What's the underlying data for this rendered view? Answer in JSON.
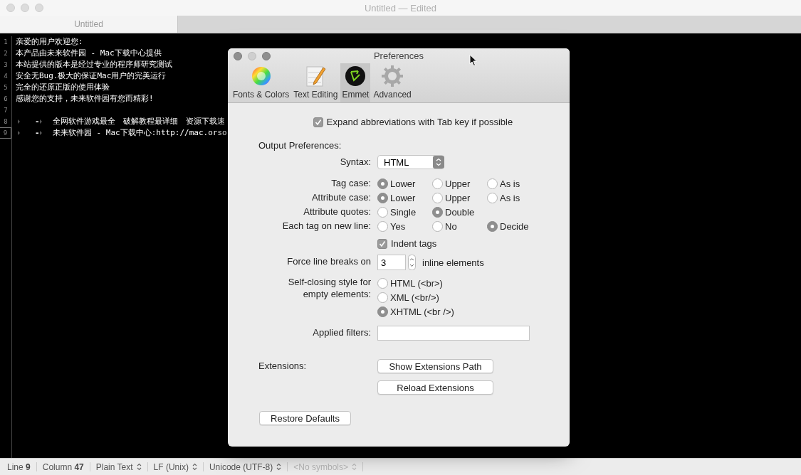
{
  "window": {
    "title": "Untitled — Edited"
  },
  "tabs": [
    {
      "label": "Untitled",
      "selected": true
    }
  ],
  "editor": {
    "lines": [
      {
        "number": "1",
        "kind": "plain",
        "text": "亲爱的用户欢迎您:",
        "current": false
      },
      {
        "number": "2",
        "kind": "plain",
        "text": "本产品由未来软件园 - Mac下载中心提供",
        "current": false
      },
      {
        "number": "3",
        "kind": "plain",
        "text": "本站提供的版本是经过专业的程序师研究测试",
        "current": false
      },
      {
        "number": "4",
        "kind": "plain",
        "text": "安全无Bug.极大的保证Mac用户的完美运行",
        "current": false
      },
      {
        "number": "5",
        "kind": "plain",
        "text": "完全的还原正版的使用体验",
        "current": false
      },
      {
        "number": "6",
        "kind": "plain",
        "text": "感谢您的支持，未来软件园有您而精彩!",
        "current": false
      },
      {
        "number": "7",
        "kind": "blank",
        "current": false
      },
      {
        "number": "8",
        "kind": "bullet",
        "bullet": "-",
        "text": "全网软件游戏最全　破解教程最详细　资源下载速",
        "current": false
      },
      {
        "number": "9",
        "kind": "bullet",
        "bullet": "-",
        "text": "未来软件园 - Mac下载中心:http://mac.orso",
        "current": true
      }
    ]
  },
  "status_bar": {
    "items": [
      {
        "kind": "count",
        "label": "Line",
        "value": "9"
      },
      {
        "kind": "count",
        "label": "Column",
        "value": "47"
      },
      {
        "kind": "popup",
        "label": "Plain Text",
        "disabled": false
      },
      {
        "kind": "popup",
        "label": "LF (Unix)",
        "disabled": false
      },
      {
        "kind": "popup",
        "label": "Unicode (UTF-8)",
        "disabled": false
      },
      {
        "kind": "popup",
        "label": "<No symbols>",
        "disabled": true
      }
    ]
  },
  "preferences": {
    "title": "Preferences",
    "tabs": [
      {
        "kind": "fonts",
        "label": "Fonts & Colors",
        "selected": false
      },
      {
        "kind": "editing",
        "label": "Text Editing",
        "selected": false
      },
      {
        "kind": "emmet",
        "label": "Emmet",
        "selected": true
      },
      {
        "kind": "advanced",
        "label": "Advanced",
        "selected": false
      }
    ],
    "expand_abbreviations": {
      "label": "Expand abbreviations with Tab key if possible",
      "checked": true
    },
    "output_heading": "Output Preferences:",
    "syntax": {
      "label": "Syntax:",
      "value": "HTML"
    },
    "radio_groups": [
      {
        "label": "Tag case:",
        "options": [
          {
            "label": "Lower",
            "selected": true
          },
          {
            "label": "Upper",
            "selected": false
          },
          {
            "label": "As is",
            "selected": false
          }
        ]
      },
      {
        "label": "Attribute case:",
        "options": [
          {
            "label": "Lower",
            "selected": true
          },
          {
            "label": "Upper",
            "selected": false
          },
          {
            "label": "As is",
            "selected": false
          }
        ]
      },
      {
        "label": "Attribute quotes:",
        "options": [
          {
            "label": "Single",
            "selected": false
          },
          {
            "label": "Double",
            "selected": true
          }
        ]
      },
      {
        "label": "Each tag on new line:",
        "options": [
          {
            "label": "Yes",
            "selected": false
          },
          {
            "label": "No",
            "selected": false
          },
          {
            "label": "Decide",
            "selected": true
          }
        ]
      }
    ],
    "indent_tags": {
      "label": "Indent tags",
      "checked": true
    },
    "line_breaks": {
      "label": "Force line breaks on",
      "value": "3",
      "suffix": "inline elements"
    },
    "self_closing": {
      "label": "Self-closing style for empty elements:",
      "options": [
        {
          "label": "HTML (<br>)",
          "selected": false
        },
        {
          "label": "XML (<br/>)",
          "selected": false
        },
        {
          "label": "XHTML (<br />)",
          "selected": true
        }
      ]
    },
    "applied_filters": {
      "label": "Applied filters:"
    },
    "extensions": {
      "label": "Extensions:",
      "buttons": [
        "Show Extensions Path",
        "Reload Extensions"
      ]
    },
    "restore_button": "Restore Defaults"
  }
}
